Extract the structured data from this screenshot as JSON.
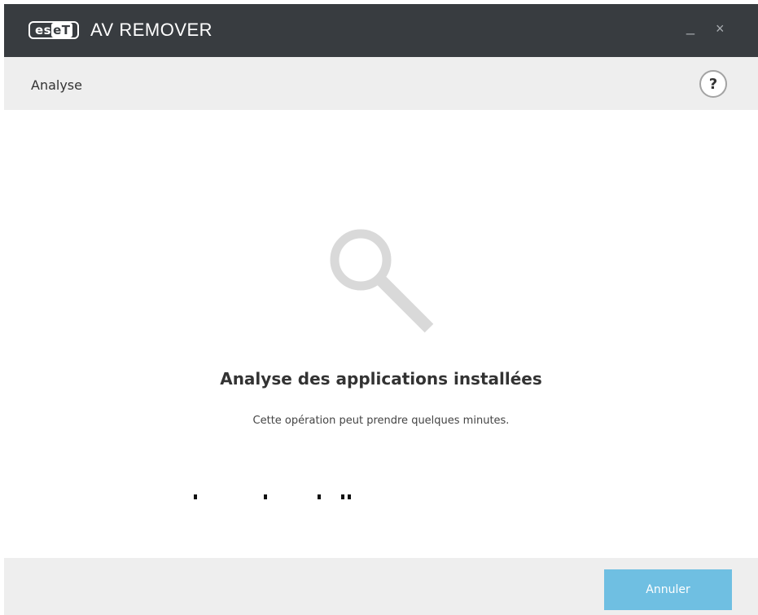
{
  "titlebar": {
    "logo_text_1": "es",
    "logo_text_2": "eT",
    "app_title": "AV REMOVER",
    "minimize_label": "_",
    "close_label": "×"
  },
  "header": {
    "title": "Analyse",
    "help_label": "?"
  },
  "main": {
    "icon": "search-icon",
    "title": "Analyse des applications installées",
    "subtitle": "Cette opération peut prendre quelques minutes."
  },
  "footer": {
    "cancel_label": "Annuler"
  },
  "colors": {
    "titlebar_bg": "#383c40",
    "header_bg": "#eeeeee",
    "button_bg": "#6fbfe2",
    "icon_color": "#d9d9d9"
  }
}
